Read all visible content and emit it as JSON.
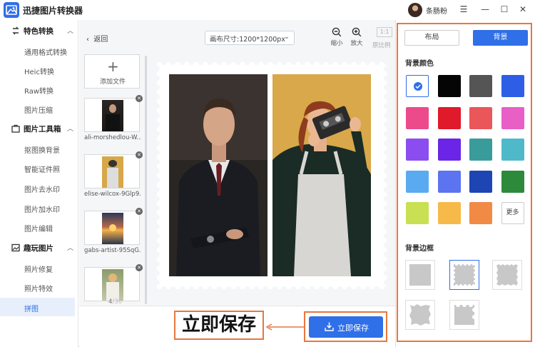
{
  "app": {
    "title": "迅捷图片转换器",
    "user": "条肠粉"
  },
  "window_controls": {
    "menu": "☰",
    "minimize": "—",
    "maximize": "☐",
    "close": "✕"
  },
  "sidebar": {
    "sections": [
      {
        "label": "特色转换",
        "items": [
          "通用格式转换",
          "Heic转换",
          "Raw转换",
          "图片压缩"
        ]
      },
      {
        "label": "图片工具箱",
        "items": [
          "抠图换背景",
          "智能证件照",
          "图片去水印",
          "图片加水印",
          "图片编辑"
        ]
      },
      {
        "label": "趣玩图片",
        "items": [
          "照片修复",
          "照片特效",
          "拼图"
        ]
      }
    ],
    "active_item": "拼图"
  },
  "toolbar": {
    "back": "返回",
    "canvas_size": "画布尺寸:1200*1200px",
    "zoom_out": "缩小",
    "zoom_in": "放大",
    "ratio_box": "1:1",
    "ratio_label": "原比例"
  },
  "files": {
    "add": "添加文件",
    "items": [
      {
        "name": "ali-morshedlou-W..."
      },
      {
        "name": "elise-wilcox-9Glp9..."
      },
      {
        "name": "gabs-artist-95SqG..."
      },
      {
        "name": ""
      }
    ],
    "current": "4",
    "total": "/30"
  },
  "save_button": "立即保存",
  "callout": "立即保存",
  "panel": {
    "tabs": [
      "布局",
      "背景"
    ],
    "active_tab": "背景",
    "bg_color_title": "背景颜色",
    "colors": [
      "#ffffff",
      "#050505",
      "#555555",
      "#2f5ee6",
      "#ec4a8b",
      "#e0192b",
      "#ea5659",
      "#e85fc6",
      "#8b4df0",
      "#6a25e6",
      "#3a9b9b",
      "#4fb9c9",
      "#5aaaf2",
      "#5c74f0",
      "#1e45b4",
      "#2c8a3a",
      "#c8e052",
      "#f7b94a",
      "#f08a45"
    ],
    "more": "更多",
    "border_title": "背景边框"
  }
}
